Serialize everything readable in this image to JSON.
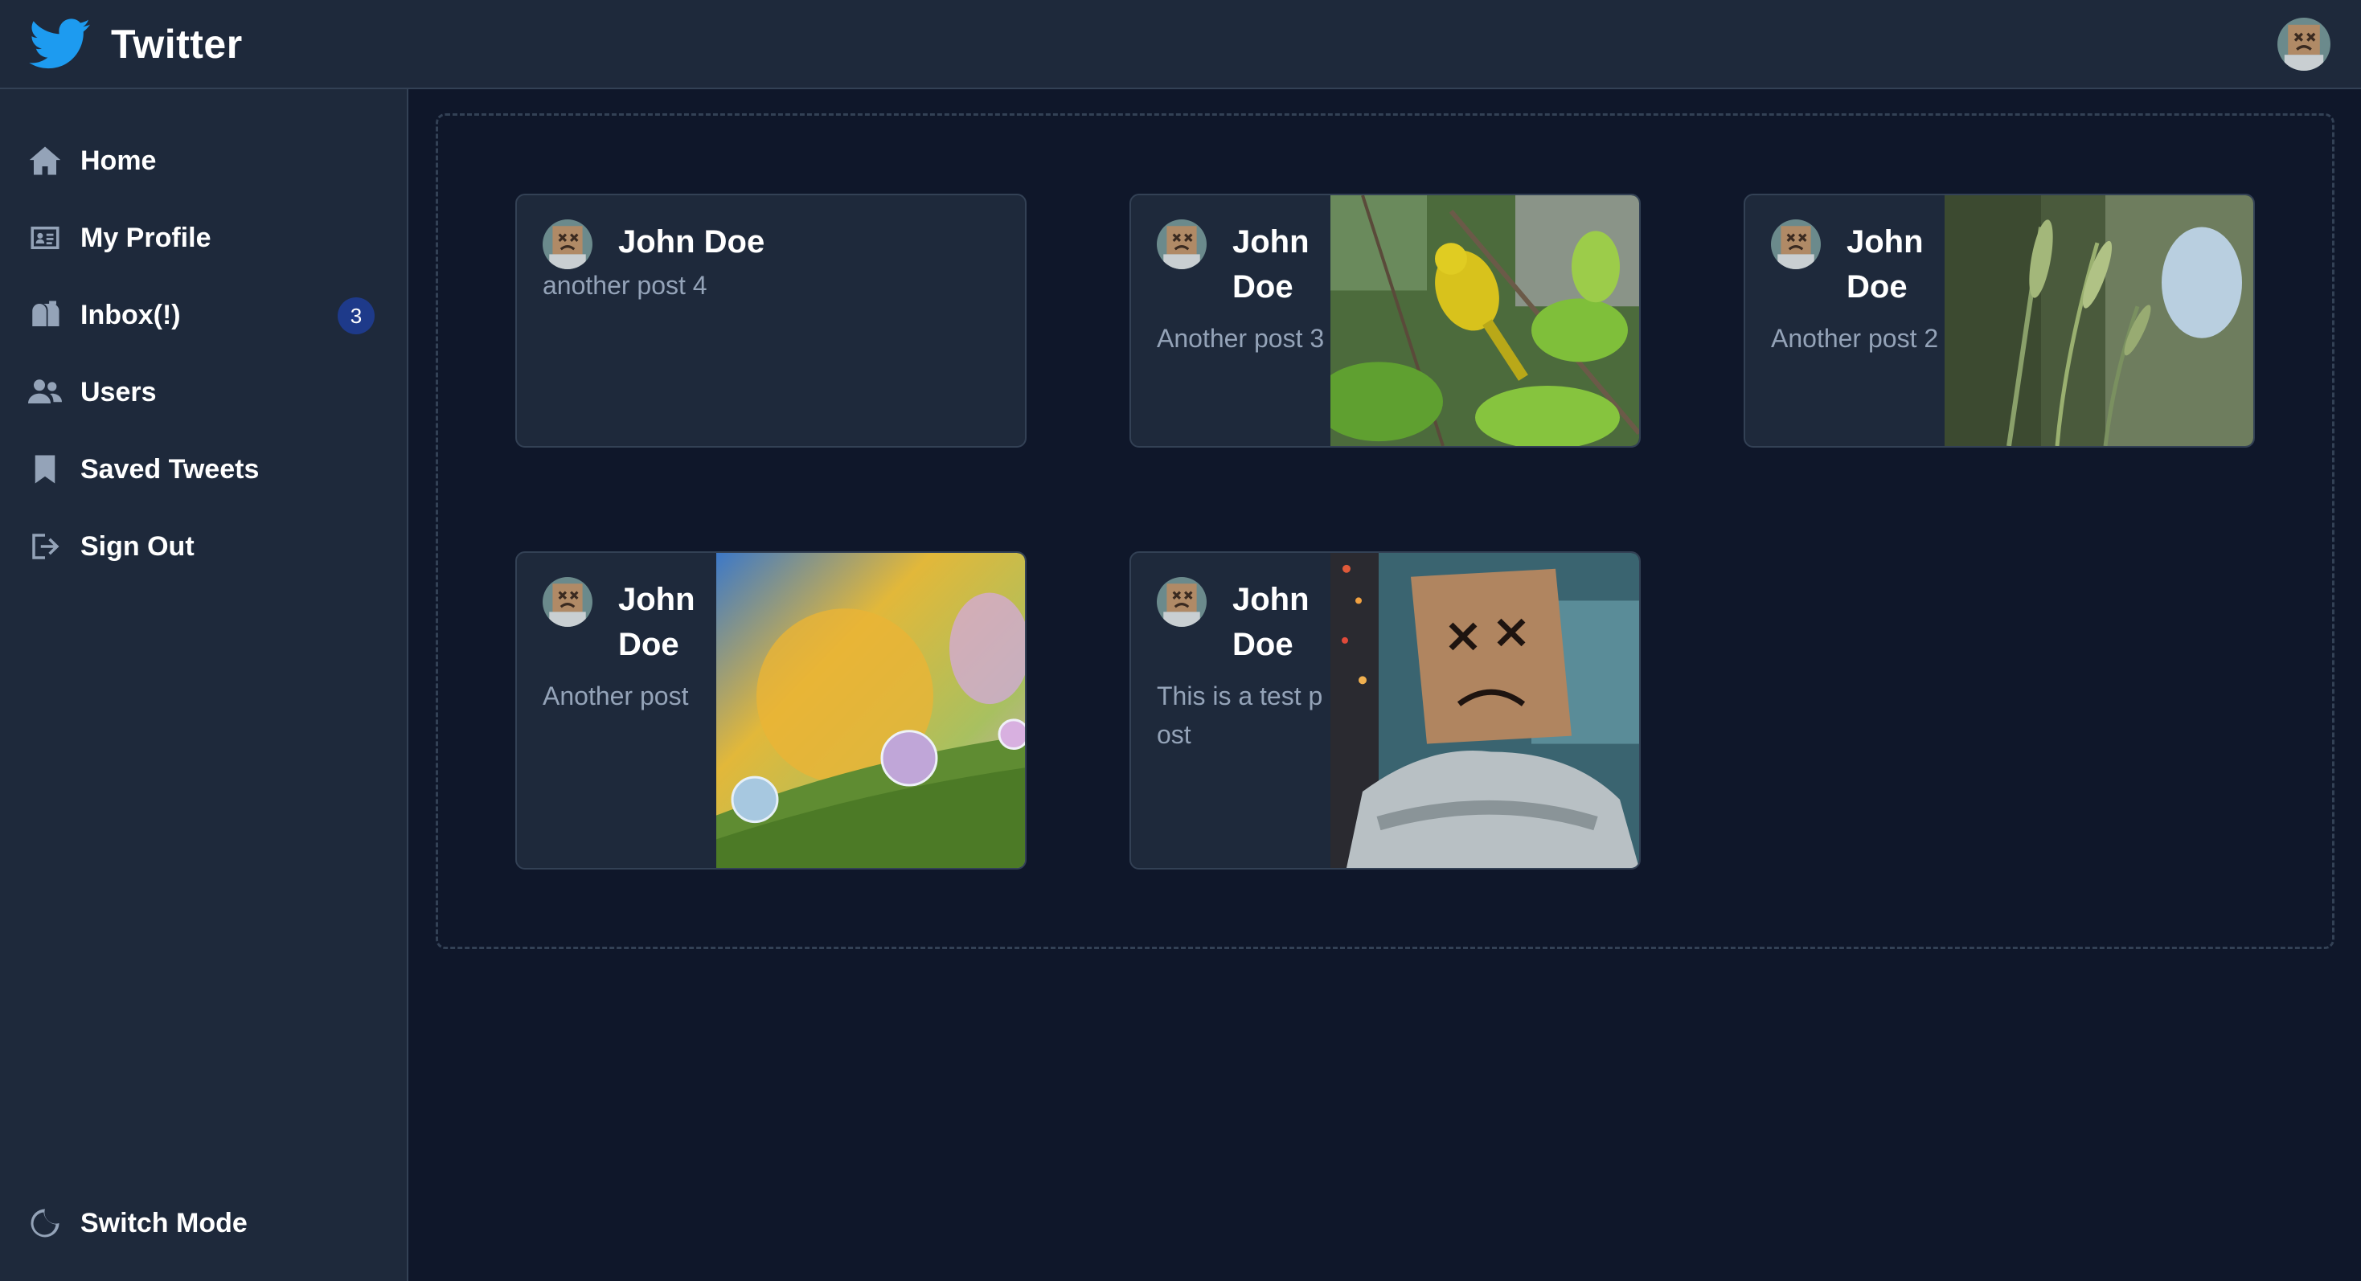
{
  "app": {
    "title": "Twitter"
  },
  "sidebar": {
    "items": [
      {
        "label": "Home",
        "icon": "home-icon"
      },
      {
        "label": "My Profile",
        "icon": "id-card-icon"
      },
      {
        "label": "Inbox(!)",
        "icon": "mailbox-icon",
        "badge": "3"
      },
      {
        "label": "Users",
        "icon": "users-icon"
      },
      {
        "label": "Saved Tweets",
        "icon": "bookmark-icon"
      },
      {
        "label": "Sign Out",
        "icon": "sign-out-icon"
      }
    ],
    "footer": {
      "label": "Switch Mode",
      "icon": "moon-icon"
    }
  },
  "posts": [
    {
      "author": "John Doe",
      "text": "another post 4",
      "image": null
    },
    {
      "author": "John Doe",
      "text": "Another post 3",
      "image": "yellow-bird-photo"
    },
    {
      "author": "John Doe",
      "text": "Another post 2",
      "image": "grass-photo"
    },
    {
      "author": "John Doe",
      "text": "Another post",
      "image": "water-drops-photo"
    },
    {
      "author": "John Doe",
      "text": "This is a test post",
      "image": "paper-bag-person-photo"
    }
  ],
  "colors": {
    "background": "#0f172a",
    "surface": "#1e293b",
    "border": "#334155",
    "muted_text": "#94a3b8",
    "badge": "#1e3a8a",
    "brand": "#1d9bf0"
  }
}
